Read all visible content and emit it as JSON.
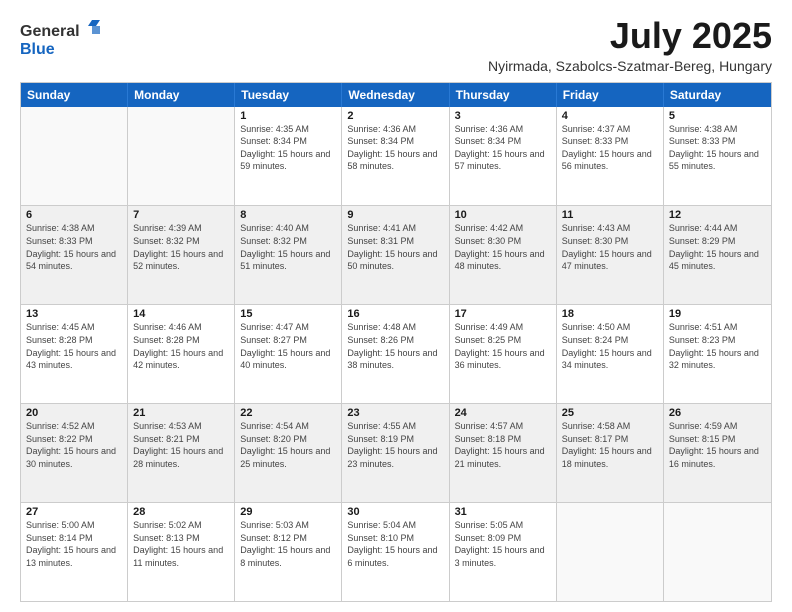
{
  "header": {
    "logo_line1": "General",
    "logo_line2": "Blue",
    "month": "July 2025",
    "location": "Nyirmada, Szabolcs-Szatmar-Bereg, Hungary"
  },
  "days_of_week": [
    "Sunday",
    "Monday",
    "Tuesday",
    "Wednesday",
    "Thursday",
    "Friday",
    "Saturday"
  ],
  "weeks": [
    [
      {
        "num": "",
        "info": "",
        "empty": true
      },
      {
        "num": "",
        "info": "",
        "empty": true
      },
      {
        "num": "1",
        "info": "Sunrise: 4:35 AM\nSunset: 8:34 PM\nDaylight: 15 hours\nand 59 minutes."
      },
      {
        "num": "2",
        "info": "Sunrise: 4:36 AM\nSunset: 8:34 PM\nDaylight: 15 hours\nand 58 minutes."
      },
      {
        "num": "3",
        "info": "Sunrise: 4:36 AM\nSunset: 8:34 PM\nDaylight: 15 hours\nand 57 minutes."
      },
      {
        "num": "4",
        "info": "Sunrise: 4:37 AM\nSunset: 8:33 PM\nDaylight: 15 hours\nand 56 minutes."
      },
      {
        "num": "5",
        "info": "Sunrise: 4:38 AM\nSunset: 8:33 PM\nDaylight: 15 hours\nand 55 minutes."
      }
    ],
    [
      {
        "num": "6",
        "info": "Sunrise: 4:38 AM\nSunset: 8:33 PM\nDaylight: 15 hours\nand 54 minutes.",
        "shaded": true
      },
      {
        "num": "7",
        "info": "Sunrise: 4:39 AM\nSunset: 8:32 PM\nDaylight: 15 hours\nand 52 minutes.",
        "shaded": true
      },
      {
        "num": "8",
        "info": "Sunrise: 4:40 AM\nSunset: 8:32 PM\nDaylight: 15 hours\nand 51 minutes.",
        "shaded": true
      },
      {
        "num": "9",
        "info": "Sunrise: 4:41 AM\nSunset: 8:31 PM\nDaylight: 15 hours\nand 50 minutes.",
        "shaded": true
      },
      {
        "num": "10",
        "info": "Sunrise: 4:42 AM\nSunset: 8:30 PM\nDaylight: 15 hours\nand 48 minutes.",
        "shaded": true
      },
      {
        "num": "11",
        "info": "Sunrise: 4:43 AM\nSunset: 8:30 PM\nDaylight: 15 hours\nand 47 minutes.",
        "shaded": true
      },
      {
        "num": "12",
        "info": "Sunrise: 4:44 AM\nSunset: 8:29 PM\nDaylight: 15 hours\nand 45 minutes.",
        "shaded": true
      }
    ],
    [
      {
        "num": "13",
        "info": "Sunrise: 4:45 AM\nSunset: 8:28 PM\nDaylight: 15 hours\nand 43 minutes."
      },
      {
        "num": "14",
        "info": "Sunrise: 4:46 AM\nSunset: 8:28 PM\nDaylight: 15 hours\nand 42 minutes."
      },
      {
        "num": "15",
        "info": "Sunrise: 4:47 AM\nSunset: 8:27 PM\nDaylight: 15 hours\nand 40 minutes."
      },
      {
        "num": "16",
        "info": "Sunrise: 4:48 AM\nSunset: 8:26 PM\nDaylight: 15 hours\nand 38 minutes."
      },
      {
        "num": "17",
        "info": "Sunrise: 4:49 AM\nSunset: 8:25 PM\nDaylight: 15 hours\nand 36 minutes."
      },
      {
        "num": "18",
        "info": "Sunrise: 4:50 AM\nSunset: 8:24 PM\nDaylight: 15 hours\nand 34 minutes."
      },
      {
        "num": "19",
        "info": "Sunrise: 4:51 AM\nSunset: 8:23 PM\nDaylight: 15 hours\nand 32 minutes."
      }
    ],
    [
      {
        "num": "20",
        "info": "Sunrise: 4:52 AM\nSunset: 8:22 PM\nDaylight: 15 hours\nand 30 minutes.",
        "shaded": true
      },
      {
        "num": "21",
        "info": "Sunrise: 4:53 AM\nSunset: 8:21 PM\nDaylight: 15 hours\nand 28 minutes.",
        "shaded": true
      },
      {
        "num": "22",
        "info": "Sunrise: 4:54 AM\nSunset: 8:20 PM\nDaylight: 15 hours\nand 25 minutes.",
        "shaded": true
      },
      {
        "num": "23",
        "info": "Sunrise: 4:55 AM\nSunset: 8:19 PM\nDaylight: 15 hours\nand 23 minutes.",
        "shaded": true
      },
      {
        "num": "24",
        "info": "Sunrise: 4:57 AM\nSunset: 8:18 PM\nDaylight: 15 hours\nand 21 minutes.",
        "shaded": true
      },
      {
        "num": "25",
        "info": "Sunrise: 4:58 AM\nSunset: 8:17 PM\nDaylight: 15 hours\nand 18 minutes.",
        "shaded": true
      },
      {
        "num": "26",
        "info": "Sunrise: 4:59 AM\nSunset: 8:15 PM\nDaylight: 15 hours\nand 16 minutes.",
        "shaded": true
      }
    ],
    [
      {
        "num": "27",
        "info": "Sunrise: 5:00 AM\nSunset: 8:14 PM\nDaylight: 15 hours\nand 13 minutes."
      },
      {
        "num": "28",
        "info": "Sunrise: 5:02 AM\nSunset: 8:13 PM\nDaylight: 15 hours\nand 11 minutes."
      },
      {
        "num": "29",
        "info": "Sunrise: 5:03 AM\nSunset: 8:12 PM\nDaylight: 15 hours\nand 8 minutes."
      },
      {
        "num": "30",
        "info": "Sunrise: 5:04 AM\nSunset: 8:10 PM\nDaylight: 15 hours\nand 6 minutes."
      },
      {
        "num": "31",
        "info": "Sunrise: 5:05 AM\nSunset: 8:09 PM\nDaylight: 15 hours\nand 3 minutes."
      },
      {
        "num": "",
        "info": "",
        "empty": true
      },
      {
        "num": "",
        "info": "",
        "empty": true
      }
    ]
  ]
}
